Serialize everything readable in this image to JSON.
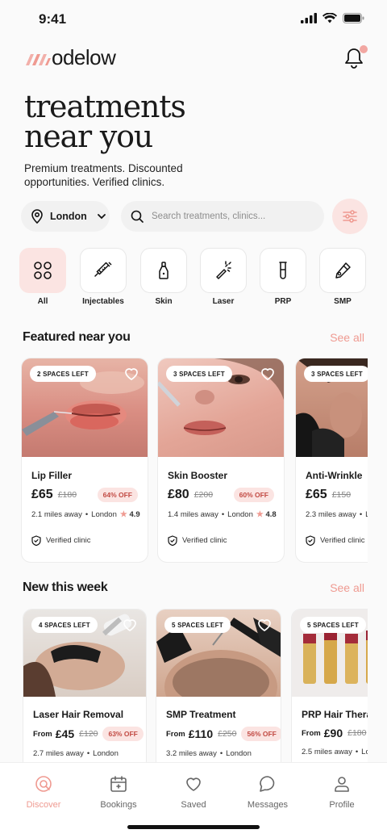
{
  "status": {
    "time": "9:41"
  },
  "brand": {
    "name": "odelow",
    "accent": "#ef9a91"
  },
  "hero": {
    "line1": "treatments",
    "line2": "near you",
    "subtitle": "Premium treatments. Discounted opportunities. Verified clinics."
  },
  "search": {
    "location": "London",
    "placeholder": "Search treatments, clinics..."
  },
  "categories": [
    {
      "label": "All",
      "icon": "grid-icon"
    },
    {
      "label": "Injectables",
      "icon": "syringe-icon"
    },
    {
      "label": "Skin",
      "icon": "serum-bottle-icon"
    },
    {
      "label": "Laser",
      "icon": "laser-wand-icon"
    },
    {
      "label": "PRP",
      "icon": "test-tube-icon"
    },
    {
      "label": "SMP",
      "icon": "pen-icon"
    }
  ],
  "featured": {
    "title": "Featured near you",
    "see_all": "See all",
    "verified_label": "Verified clinic",
    "cards": [
      {
        "badge": "2 SPACES LEFT",
        "name": "Lip Filler",
        "price": "£65",
        "old": "£180",
        "off": "64% OFF",
        "distance": "2.1 miles away",
        "city": "London",
        "rating": "4.9"
      },
      {
        "badge": "3 SPACES LEFT",
        "name": "Skin Booster",
        "price": "£80",
        "old": "£200",
        "off": "60% OFF",
        "distance": "1.4 miles away",
        "city": "London",
        "rating": "4.8"
      },
      {
        "badge": "3 SPACES LEFT",
        "name": "Anti-Wrinkle",
        "price": "£65",
        "old": "£150",
        "off": "",
        "distance": "2.3 miles away",
        "city": "Lo",
        "rating": ""
      }
    ]
  },
  "new_week": {
    "title": "New this week",
    "see_all": "See all",
    "from_label": "From",
    "cards": [
      {
        "badge": "4 SPACES LEFT",
        "name": "Laser Hair Removal",
        "price": "£45",
        "old": "£120",
        "off": "63% OFF",
        "distance": "2.7 miles away",
        "city": "London"
      },
      {
        "badge": "5 SPACES LEFT",
        "name": "SMP Treatment",
        "price": "£110",
        "old": "£250",
        "off": "56% OFF",
        "distance": "3.2 miles away",
        "city": "London"
      },
      {
        "badge": "5 SPACES LEFT",
        "name": "PRP Hair Therapy",
        "price": "£90",
        "old": "£180",
        "off": "",
        "distance": "2.5 miles away",
        "city": "Lo"
      }
    ]
  },
  "tabs": [
    {
      "label": "Discover",
      "icon": "discover-icon",
      "active": true
    },
    {
      "label": "Bookings",
      "icon": "calendar-icon",
      "active": false
    },
    {
      "label": "Saved",
      "icon": "heart-icon",
      "active": false
    },
    {
      "label": "Messages",
      "icon": "chat-icon",
      "active": false
    },
    {
      "label": "Profile",
      "icon": "user-icon",
      "active": false
    }
  ]
}
